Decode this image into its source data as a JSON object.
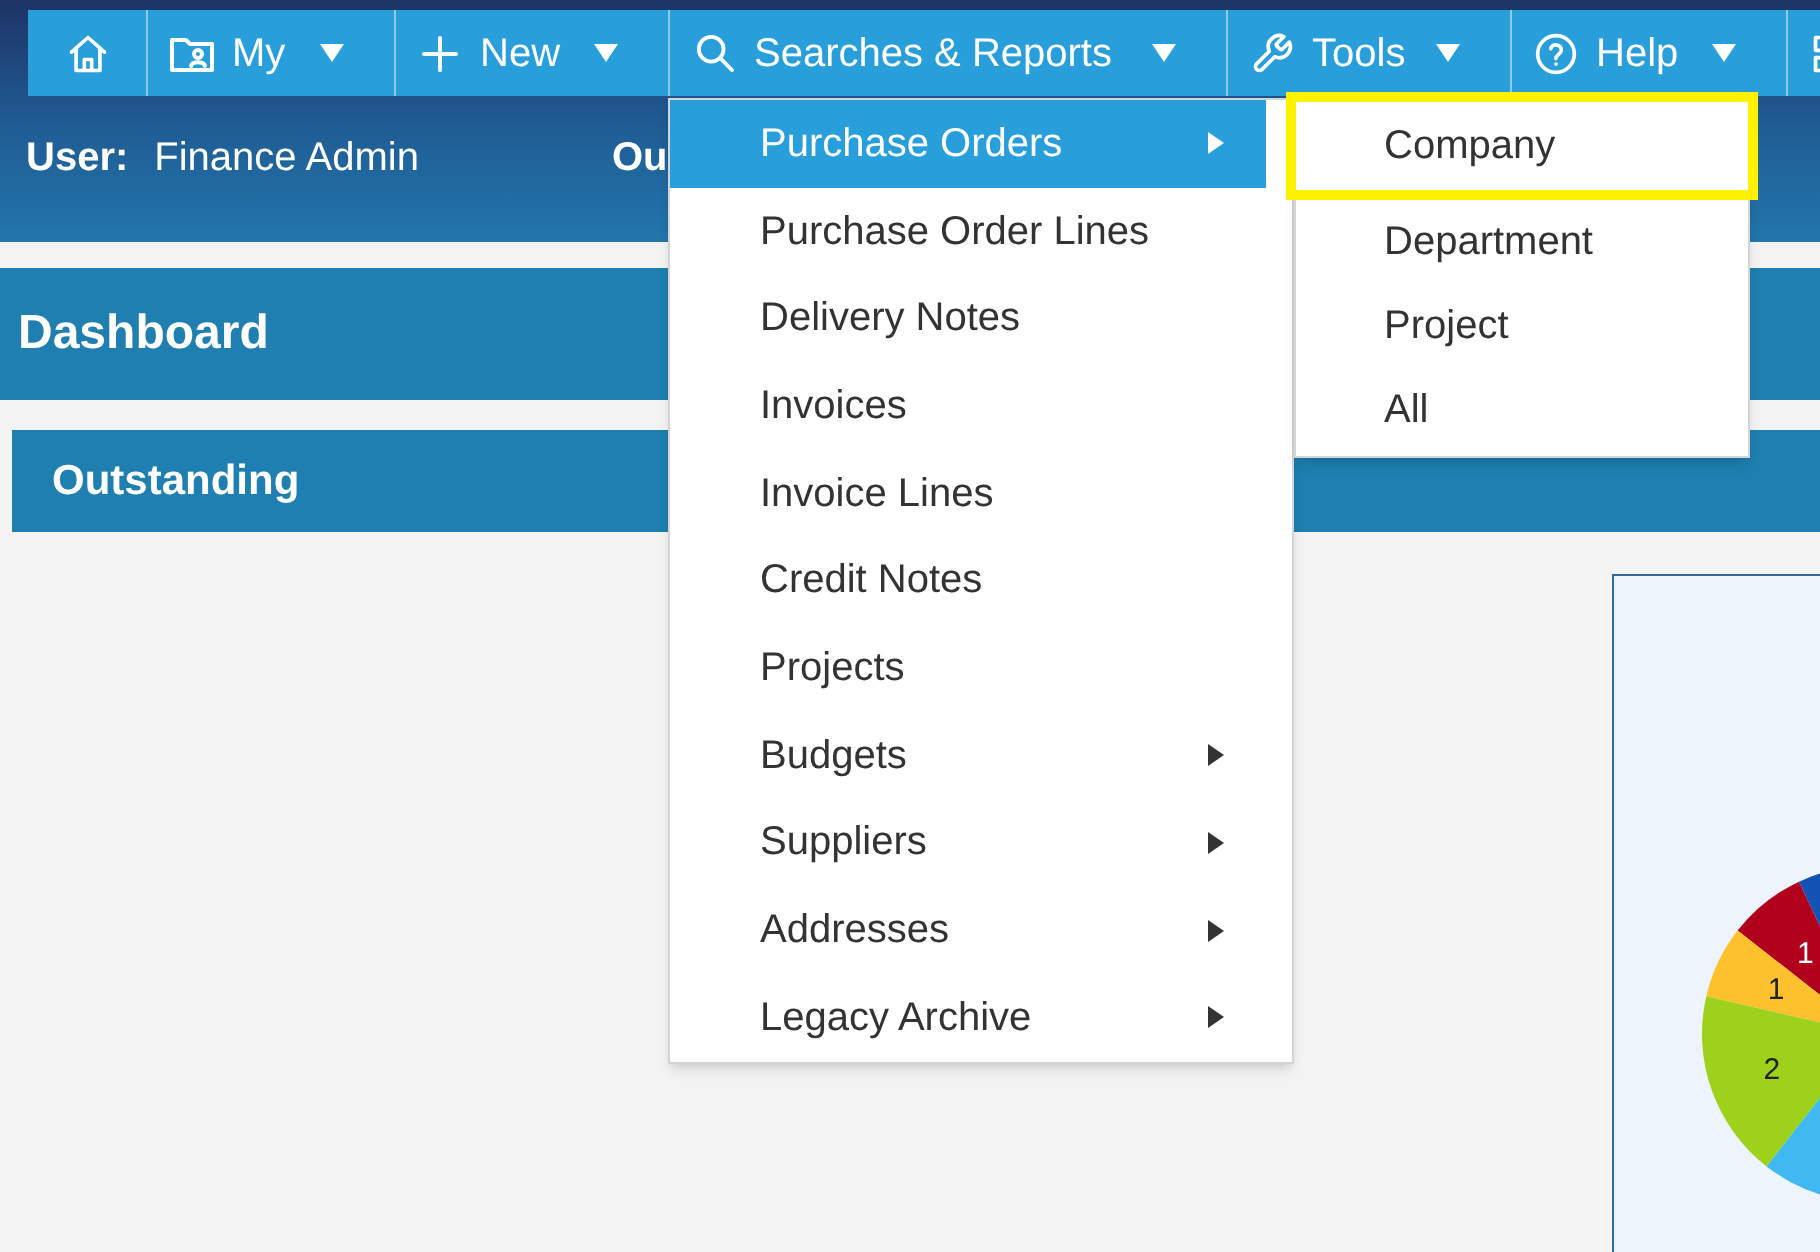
{
  "nav_bar": {
    "items": [
      {
        "kind": "icon"
      },
      {
        "kind": "text",
        "label": "My",
        "has_caret": true
      },
      {
        "kind": "text",
        "label": "New",
        "has_caret": true
      },
      {
        "kind": "text",
        "label": "Searches & Reports",
        "has_caret": true
      },
      {
        "kind": "text",
        "label": "Tools",
        "has_caret": true
      },
      {
        "kind": "text",
        "label": "Help",
        "has_caret": true
      },
      {
        "kind": "icon"
      }
    ]
  },
  "user_bar": {
    "label": "User:",
    "value": "Finance Admin",
    "next_label": "Ou"
  },
  "dashboard": {
    "title": "Dashboard",
    "section_title": "Outstanding",
    "pie_chart": {
      "slices": [
        {
          "color": "#1552b5"
        },
        {
          "color": "#b0001c",
          "label": "1"
        },
        {
          "color": "#fcc12c",
          "label": "1"
        },
        {
          "color": "#9dd11c",
          "label": "2"
        },
        {
          "color": "#40b8f0"
        }
      ]
    }
  },
  "menu": {
    "items": [
      {
        "label": "Purchase Orders",
        "selected": true,
        "has_submenu": true
      },
      {
        "label": "Purchase Order Lines",
        "selected": false,
        "has_submenu": false
      },
      {
        "label": "Delivery Notes",
        "selected": false,
        "has_submenu": false
      },
      {
        "label": "Invoices",
        "selected": false,
        "has_submenu": false
      },
      {
        "label": "Invoice Lines",
        "selected": false,
        "has_submenu": false
      },
      {
        "label": "Credit Notes",
        "selected": false,
        "has_submenu": false
      },
      {
        "label": "Projects",
        "selected": false,
        "has_submenu": false
      },
      {
        "label": "Budgets",
        "selected": false,
        "has_submenu": true
      },
      {
        "label": "Suppliers",
        "selected": false,
        "has_submenu": true
      },
      {
        "label": "Addresses",
        "selected": false,
        "has_submenu": true
      },
      {
        "label": "Legacy Archive",
        "selected": false,
        "has_submenu": true
      }
    ]
  },
  "submenu": {
    "items": [
      {
        "label": "Company",
        "selected": false,
        "outlined": true
      },
      {
        "label": "Department",
        "selected": false,
        "outlined": false
      },
      {
        "label": "Project",
        "selected": false,
        "outlined": false
      },
      {
        "label": "All",
        "selected": false,
        "outlined": false
      }
    ]
  }
}
